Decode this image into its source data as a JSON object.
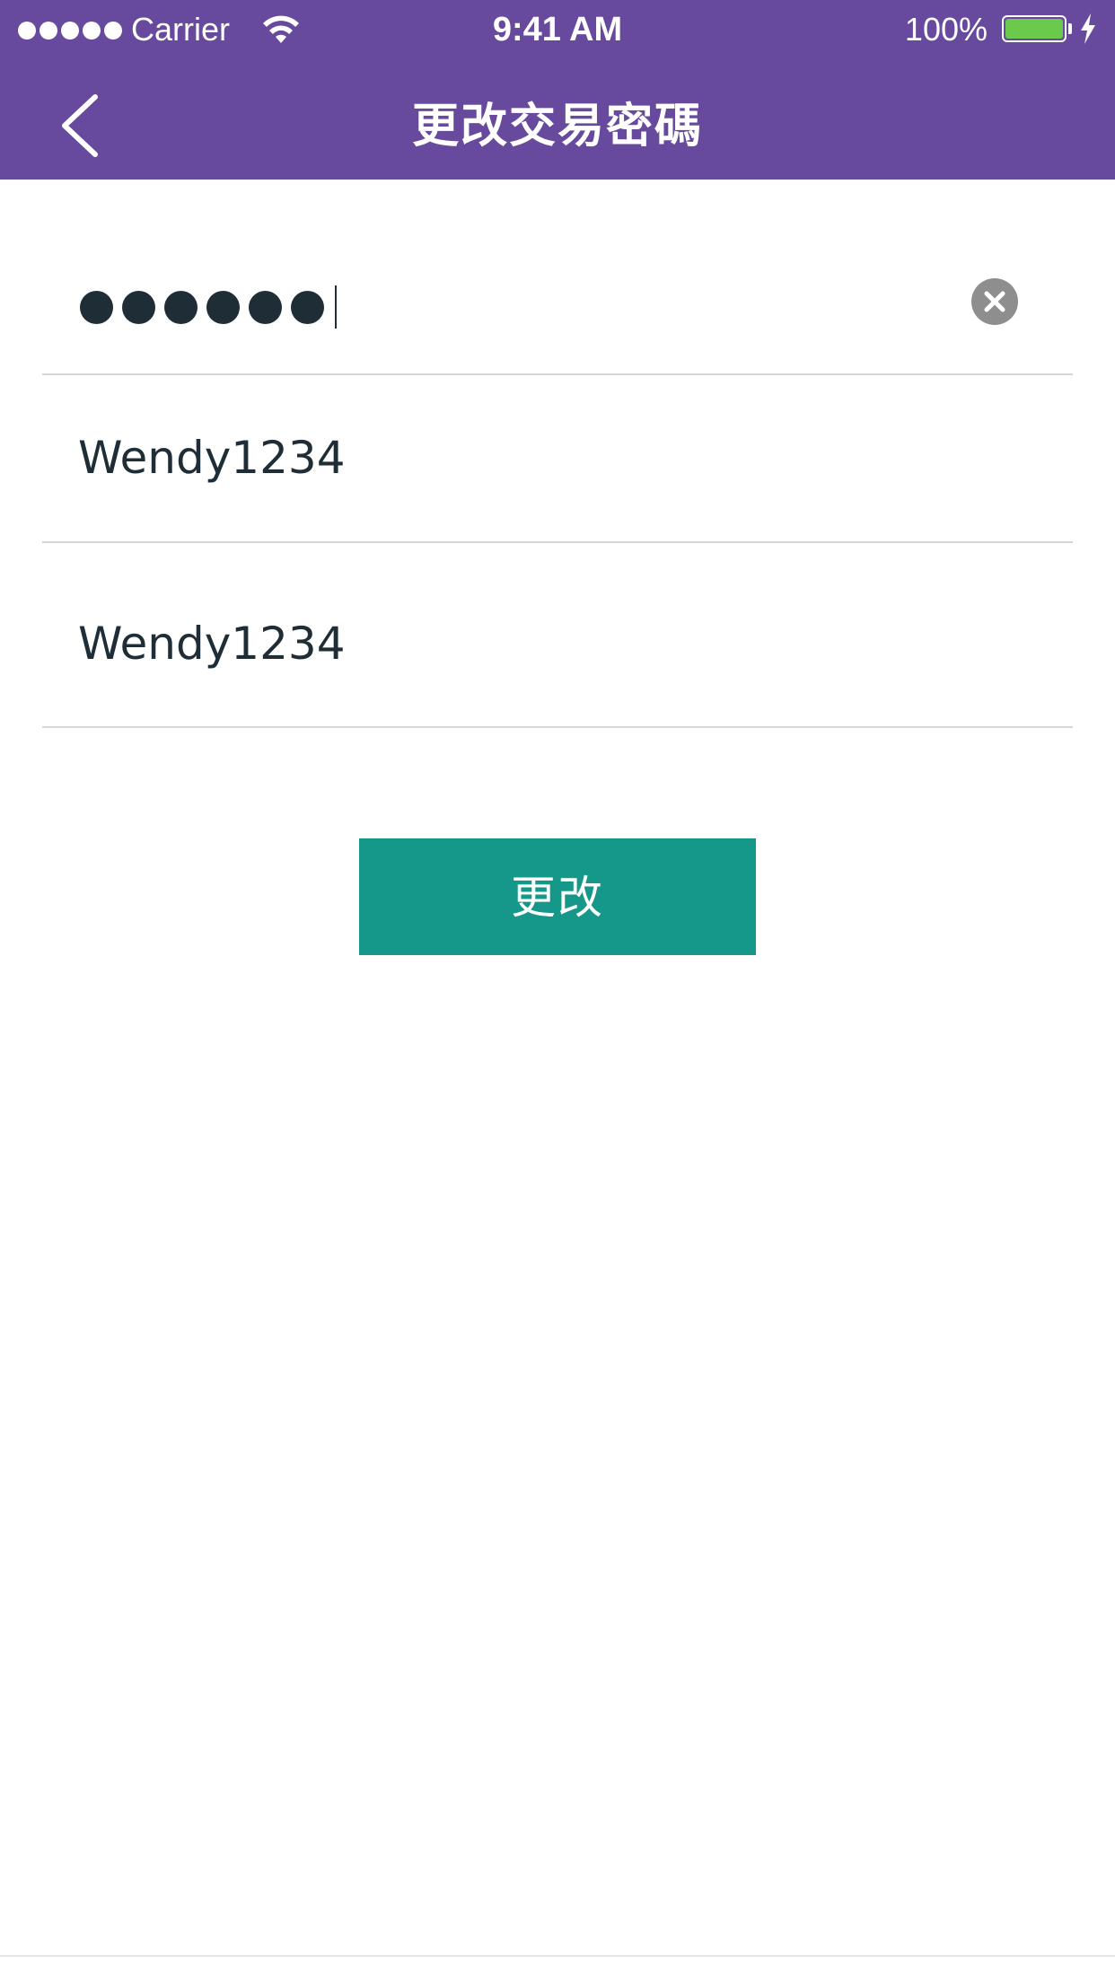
{
  "status_bar": {
    "carrier": "Carrier",
    "time": "9:41 AM",
    "battery": "100%",
    "signal_icon": "signal-dots-icon",
    "wifi_icon": "wifi-icon",
    "battery_icon": "battery-icon",
    "charging_icon": "charging-bolt-icon"
  },
  "header": {
    "title": "更改交易密碼",
    "back_icon": "chevron-left-icon",
    "background_color": "#67499d"
  },
  "form": {
    "old_password": {
      "masked_length": 6,
      "clear_icon": "clear-circle-icon"
    },
    "new_password": {
      "value": "Wendy1234"
    },
    "confirm_password": {
      "value": "Wendy1234"
    },
    "submit_label": "更改",
    "submit_color": "#15978a"
  }
}
